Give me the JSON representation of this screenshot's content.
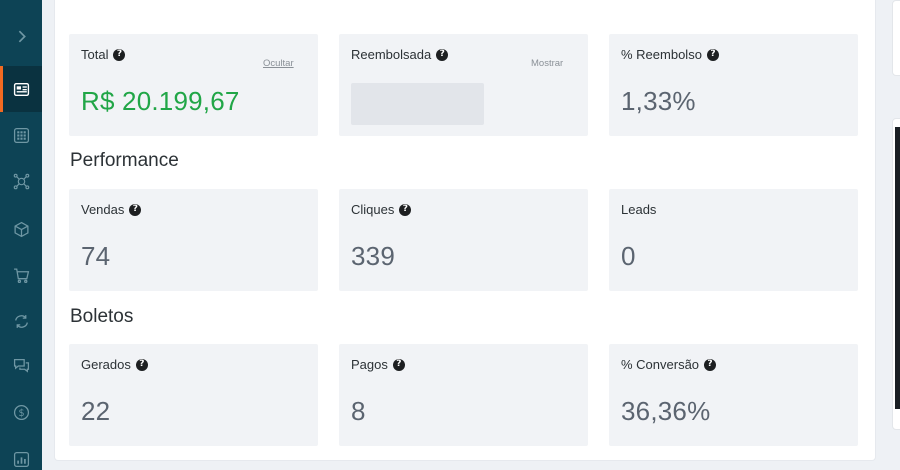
{
  "sidebar": {
    "items": [
      {
        "icon": "chevron-right-icon"
      },
      {
        "icon": "dashboard-icon",
        "active": true
      },
      {
        "icon": "grid-icon"
      },
      {
        "icon": "affiliate-network-icon"
      },
      {
        "icon": "cube-icon"
      },
      {
        "icon": "cart-icon"
      },
      {
        "icon": "refresh-icon"
      },
      {
        "icon": "chat-icon"
      },
      {
        "icon": "dollar-icon"
      },
      {
        "icon": "report-icon"
      }
    ]
  },
  "summary": {
    "total": {
      "label": "Total",
      "value": "R$ 20.199,67",
      "toggle": "Ocultar"
    },
    "refunded": {
      "label": "Reembolsada",
      "toggle": "Mostrar"
    },
    "refund_rate": {
      "label": "% Reembolso",
      "value": "1,33%"
    }
  },
  "performance": {
    "title": "Performance",
    "sales": {
      "label": "Vendas",
      "value": "74"
    },
    "clicks": {
      "label": "Cliques",
      "value": "339"
    },
    "leads": {
      "label": "Leads",
      "value": "0"
    }
  },
  "boletos": {
    "title": "Boletos",
    "generated": {
      "label": "Gerados",
      "value": "22"
    },
    "paid": {
      "label": "Pagos",
      "value": "8"
    },
    "conversion": {
      "label": "% Conversão",
      "value": "36,36%"
    }
  },
  "colors": {
    "sidebar_bg": "#0d4355",
    "active_accent": "#f26a21",
    "positive_value": "#21a647"
  }
}
